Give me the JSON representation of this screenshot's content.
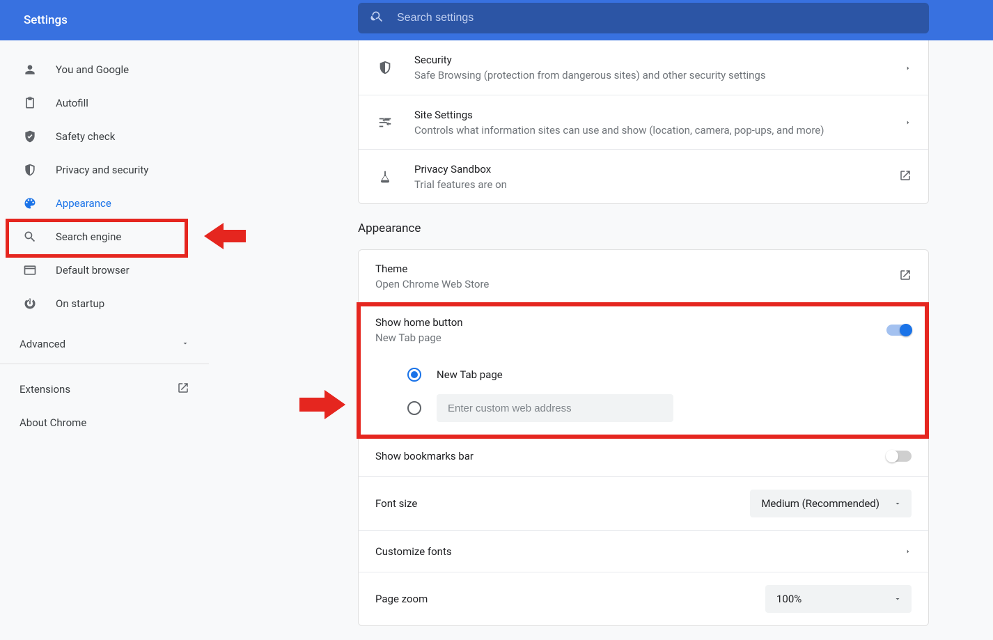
{
  "header": {
    "title": "Settings"
  },
  "search": {
    "placeholder": "Search settings"
  },
  "sidebar": {
    "items": [
      {
        "label": "You and Google"
      },
      {
        "label": "Autofill"
      },
      {
        "label": "Safety check"
      },
      {
        "label": "Privacy and security"
      },
      {
        "label": "Appearance"
      },
      {
        "label": "Search engine"
      },
      {
        "label": "Default browser"
      },
      {
        "label": "On startup"
      }
    ],
    "advanced": "Advanced",
    "extensions": "Extensions",
    "about": "About Chrome"
  },
  "privacy_card": {
    "security": {
      "title": "Security",
      "sub": "Safe Browsing (protection from dangerous sites) and other security settings"
    },
    "site": {
      "title": "Site Settings",
      "sub": "Controls what information sites can use and show (location, camera, pop-ups, and more)"
    },
    "sandbox": {
      "title": "Privacy Sandbox",
      "sub": "Trial features are on"
    }
  },
  "section": {
    "appearance": "Appearance"
  },
  "appearance": {
    "theme": {
      "title": "Theme",
      "sub": "Open Chrome Web Store"
    },
    "home": {
      "title": "Show home button",
      "sub": "New Tab page",
      "option_newtab": "New Tab page",
      "custom_placeholder": "Enter custom web address"
    },
    "bookmarks": {
      "title": "Show bookmarks bar"
    },
    "fontsize": {
      "title": "Font size",
      "value": "Medium (Recommended)"
    },
    "customfonts": {
      "title": "Customize fonts"
    },
    "zoom": {
      "title": "Page zoom",
      "value": "100%"
    }
  }
}
